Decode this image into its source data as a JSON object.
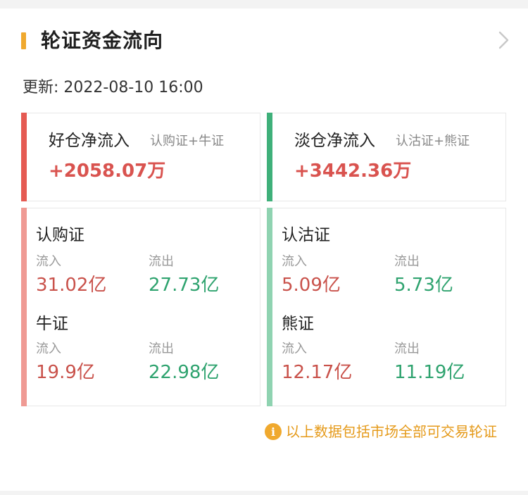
{
  "header": {
    "title": "轮证资金流向"
  },
  "update": {
    "label": "更新: 2022-08-10 16:00"
  },
  "bullish": {
    "label": "好仓净流入",
    "sub": "认购证+牛证",
    "net": "+2058.07万",
    "accent_color": "#e55a52",
    "soft_accent_color": "#ef9a94",
    "call": {
      "title": "认购证",
      "in_label": "流入",
      "in_value": "31.02亿",
      "out_label": "流出",
      "out_value": "27.73亿"
    },
    "bull": {
      "title": "牛证",
      "in_label": "流入",
      "in_value": "19.9亿",
      "out_label": "流出",
      "out_value": "22.98亿"
    }
  },
  "bearish": {
    "label": "淡仓净流入",
    "sub": "认沽证+熊证",
    "net": "+3442.36万",
    "accent_color": "#3fb07a",
    "soft_accent_color": "#8fd3b1",
    "put": {
      "title": "认沽证",
      "in_label": "流入",
      "in_value": "5.09亿",
      "out_label": "流出",
      "out_value": "5.73亿"
    },
    "bear": {
      "title": "熊证",
      "in_label": "流入",
      "in_value": "12.17亿",
      "out_label": "流出",
      "out_value": "11.19亿"
    }
  },
  "note": {
    "icon": "info-icon",
    "icon_glyph": "i",
    "text": "以上数据包括市场全部可交易轮证"
  }
}
